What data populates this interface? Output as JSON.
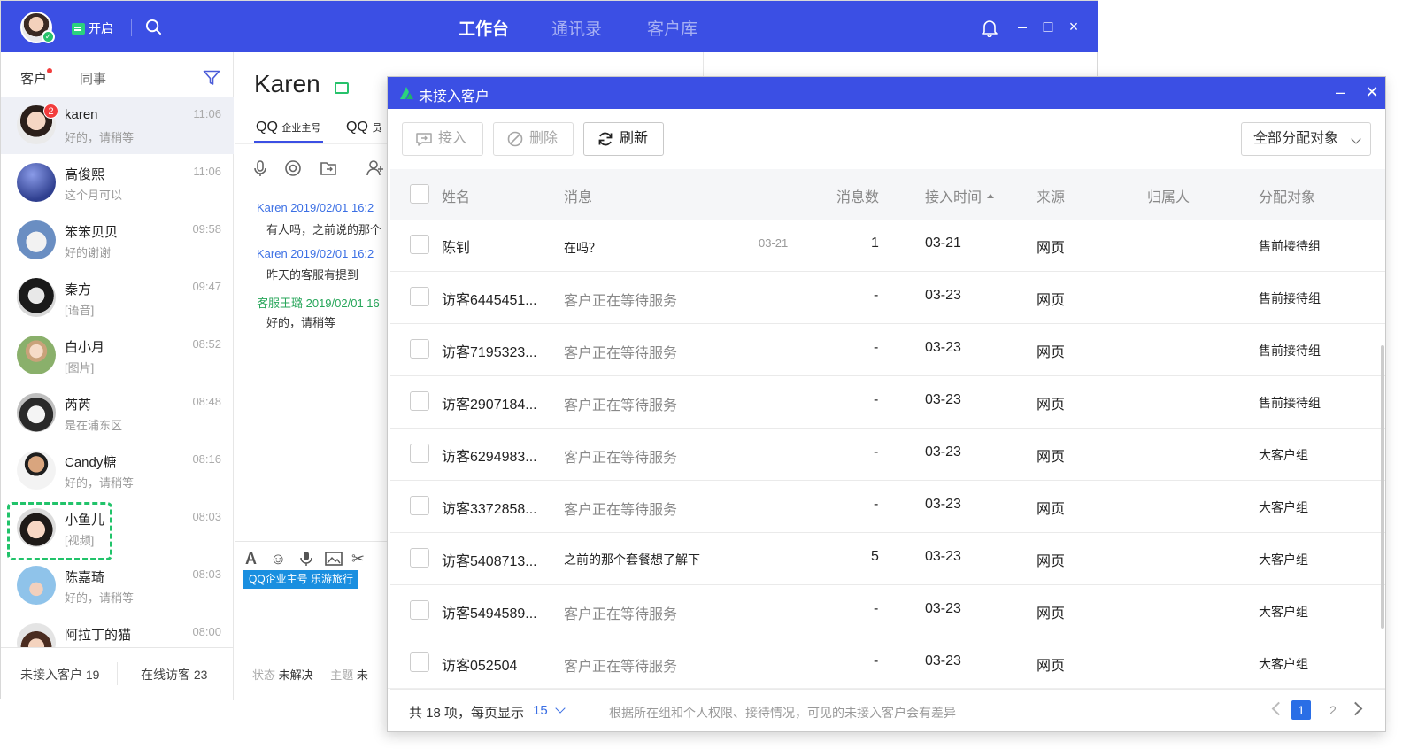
{
  "topbar": {
    "open_label": "开启",
    "tabs": [
      "工作台",
      "通讯录",
      "客户库"
    ],
    "active_tab": "工作台",
    "controls": {
      "minimize": "–",
      "maximize": "□",
      "close": "×"
    }
  },
  "sidebar": {
    "tabs": [
      "客户",
      "同事"
    ],
    "contacts": [
      {
        "name": "karen",
        "message": "好的，请稍等",
        "time": "11:06",
        "unread": "2"
      },
      {
        "name": "高俊熙",
        "message": "这个月可以",
        "time": "11:06"
      },
      {
        "name": "笨笨贝贝",
        "message": "好的谢谢",
        "time": "09:58"
      },
      {
        "name": "秦方",
        "message": "[语音]",
        "time": "09:47"
      },
      {
        "name": "白小月",
        "message": "[图片]",
        "time": "08:52"
      },
      {
        "name": "芮芮",
        "message": "是在浦东区",
        "time": "08:48"
      },
      {
        "name": "Candy糖",
        "message": "好的，请稍等",
        "time": "08:16"
      },
      {
        "name": "小鱼儿",
        "message": "[视频]",
        "time": "08:03"
      },
      {
        "name": "陈嘉琦",
        "message": "好的，请稍等",
        "time": "08:03"
      },
      {
        "name": "阿拉丁的猫",
        "message": "",
        "time": "08:00"
      }
    ],
    "footer": {
      "unreceived": "未接入客户 19",
      "online": "在线访客 23"
    }
  },
  "chat": {
    "contact_name": "Karen",
    "tabs": {
      "tab1_main": "QQ",
      "tab1_sub": "企业主号",
      "tab2_main": "QQ",
      "tab2_sub": "员"
    },
    "messages": [
      {
        "header": "Karen 2019/02/01 16:2",
        "body": "有人吗，之前说的那个"
      },
      {
        "header": "Karen 2019/02/01 16:2",
        "body": "昨天的客服有提到"
      },
      {
        "header": "客服王璐 2019/02/01 16",
        "body": "好的，请稍等"
      }
    ],
    "input_tag": "QQ企业主号 乐游旅行",
    "footer": {
      "status_label": "状态",
      "status_value": "未解决",
      "topic_label": "主题",
      "topic_value": "未"
    }
  },
  "dialog": {
    "title": "未接入客户",
    "toolbar": {
      "accept": "接入",
      "delete": "删除",
      "refresh": "刷新",
      "assign_select": "全部分配对象"
    },
    "columns": {
      "name": "姓名",
      "message": "消息",
      "count": "消息数",
      "time": "接入时间",
      "source": "来源",
      "owner": "归属人",
      "assignee": "分配对象"
    },
    "rows": [
      {
        "name": "陈钊",
        "message": "在吗？",
        "msg_time": "03-21",
        "count": "1",
        "time": "03-21",
        "source": "网页",
        "owner": "",
        "assignee": "售前接待组"
      },
      {
        "name": "访客6445451...",
        "message": "客户正在等待服务",
        "msg_time": "",
        "count": "-",
        "time": "03-23",
        "source": "网页",
        "owner": "",
        "assignee": "售前接待组"
      },
      {
        "name": "访客7195323...",
        "message": "客户正在等待服务",
        "msg_time": "",
        "count": "-",
        "time": "03-23",
        "source": "网页",
        "owner": "",
        "assignee": "售前接待组"
      },
      {
        "name": "访客2907184...",
        "message": "客户正在等待服务",
        "msg_time": "",
        "count": "-",
        "time": "03-23",
        "source": "网页",
        "owner": "",
        "assignee": "售前接待组"
      },
      {
        "name": "访客6294983...",
        "message": "客户正在等待服务",
        "msg_time": "",
        "count": "-",
        "time": "03-23",
        "source": "网页",
        "owner": "",
        "assignee": "大客户组"
      },
      {
        "name": "访客3372858...",
        "message": "客户正在等待服务",
        "msg_time": "",
        "count": "-",
        "time": "03-23",
        "source": "网页",
        "owner": "",
        "assignee": "大客户组"
      },
      {
        "name": "访客5408713...",
        "message": "之前的那个套餐想了解下",
        "msg_time": "",
        "count": "5",
        "time": "03-23",
        "source": "网页",
        "owner": "",
        "assignee": "大客户组"
      },
      {
        "name": "访客5494589...",
        "message": "客户正在等待服务",
        "msg_time": "",
        "count": "-",
        "time": "03-23",
        "source": "网页",
        "owner": "",
        "assignee": "大客户组"
      },
      {
        "name": "访客052504",
        "message": "客户正在等待服务",
        "msg_time": "",
        "count": "-",
        "time": "03-23",
        "source": "网页",
        "owner": "",
        "assignee": "大客户组"
      }
    ],
    "footer": {
      "total": "共 18 项，每页显示",
      "page_size": "15",
      "note": "根据所在组和个人权限、接待情况，可见的未接入客户会有差异",
      "pages": [
        "1",
        "2"
      ],
      "current_page": "1"
    }
  },
  "colors": {
    "brand": "#3b4fe4",
    "online_green": "#27c26b",
    "unread_red": "#f23d3d",
    "page_active": "#2a6ee6"
  }
}
